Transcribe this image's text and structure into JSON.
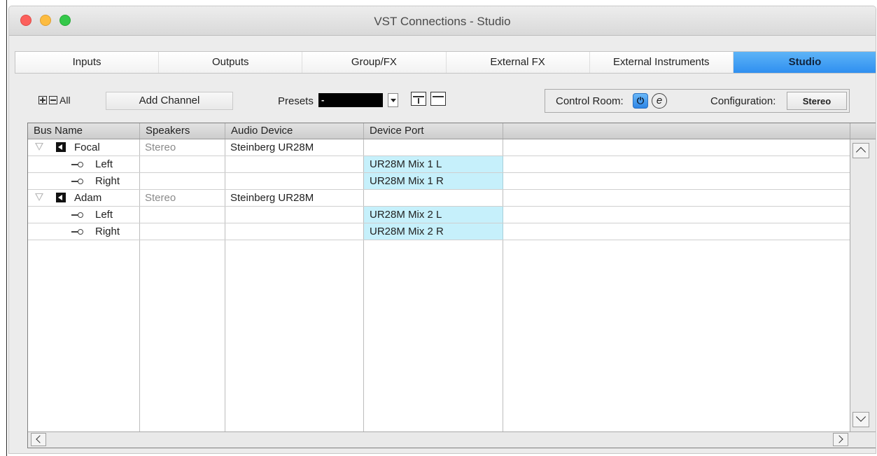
{
  "window": {
    "title": "VST Connections - Studio"
  },
  "tabs": [
    {
      "label": "Inputs",
      "active": false
    },
    {
      "label": "Outputs",
      "active": false
    },
    {
      "label": "Group/FX",
      "active": false
    },
    {
      "label": "External FX",
      "active": false
    },
    {
      "label": "External Instruments",
      "active": false
    },
    {
      "label": "Studio",
      "active": true
    }
  ],
  "toolbar": {
    "all_label": "All",
    "add_channel_label": "Add Channel",
    "presets_label": "Presets",
    "presets_value": "-",
    "control_room_label": "Control Room:",
    "control_room_power_glyph": "⏻",
    "control_room_ext_glyph": "e",
    "configuration_label": "Configuration:",
    "configuration_value": "Stereo"
  },
  "table": {
    "columns": [
      "Bus Name",
      "Speakers",
      "Audio Device",
      "Device Port"
    ],
    "rows": [
      {
        "type": "bus",
        "name": "Focal",
        "speakers": "Stereo",
        "device": "Steinberg UR28M",
        "port": ""
      },
      {
        "type": "channel",
        "name": "Left",
        "speakers": "",
        "device": "",
        "port": "UR28M Mix 1 L"
      },
      {
        "type": "channel",
        "name": "Right",
        "speakers": "",
        "device": "",
        "port": "UR28M Mix 1 R"
      },
      {
        "type": "bus",
        "name": "Adam",
        "speakers": "Stereo",
        "device": "Steinberg UR28M",
        "port": ""
      },
      {
        "type": "channel",
        "name": "Left",
        "speakers": "",
        "device": "",
        "port": "UR28M Mix 2 L"
      },
      {
        "type": "channel",
        "name": "Right",
        "speakers": "",
        "device": "",
        "port": "UR28M Mix 2 R"
      }
    ]
  },
  "colors": {
    "active_tab": "#3a96f2",
    "port_highlight": "#c6f0fb",
    "close": "#fc605c",
    "minimize": "#fdbc40",
    "maximize": "#34c84a"
  }
}
